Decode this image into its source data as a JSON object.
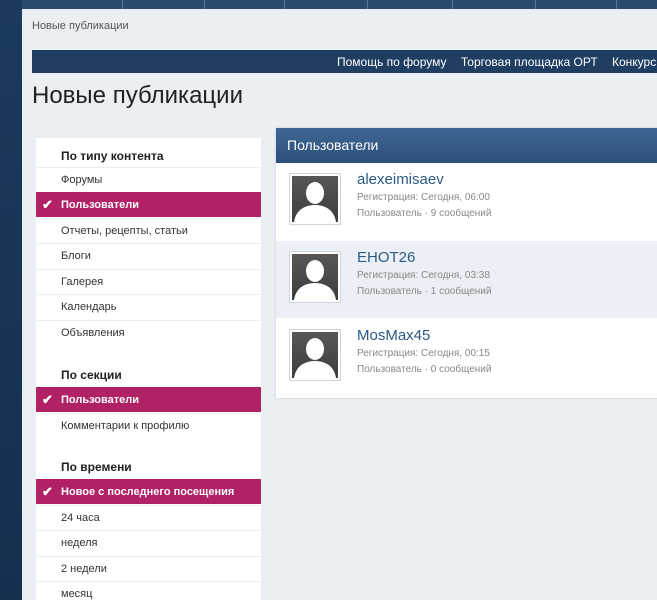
{
  "breadcrumb": "Новые публикации",
  "nav": {
    "links": [
      "Помощь по форуму",
      "Торговая площадка ОРТ",
      "Конкурсы"
    ]
  },
  "page_title": "Новые публикации",
  "sidebar": {
    "content_type": {
      "title": "По типу контента",
      "items": [
        "Форумы",
        "Пользователи",
        "Отчеты, рецепты, статьи",
        "Блоги",
        "Галерея",
        "Календарь",
        "Объявления"
      ],
      "active": "Пользователи"
    },
    "section": {
      "title": "По секции",
      "items": [
        "Пользователи",
        "Комментарии к профилю"
      ],
      "active": "Пользователи"
    },
    "time": {
      "title": "По времени",
      "items": [
        "Новое с последнего посещения",
        "24 часа",
        "неделя",
        "2 недели",
        "месяц"
      ],
      "active": "Новое с последнего посещения"
    }
  },
  "panel": {
    "title": "Пользователи",
    "users": [
      {
        "name": "alexeimisaev",
        "registered": "Регистрация: Сегодня, 06:00",
        "info": "Пользователь · 9 сообщений"
      },
      {
        "name": "EHOT26",
        "registered": "Регистрация: Сегодня, 03:38",
        "info": "Пользователь · 1 сообщений"
      },
      {
        "name": "MosMax45",
        "registered": "Регистрация: Сегодня, 00:15",
        "info": "Пользователь · 0 сообщений"
      }
    ]
  },
  "colors": {
    "accent": "#b12165",
    "header": "#1f3e61",
    "panel_head": "#3f6694",
    "link": "#2b5a84"
  },
  "icons": {
    "check": "checkmark-icon",
    "avatar": "default-user-avatar-icon"
  }
}
